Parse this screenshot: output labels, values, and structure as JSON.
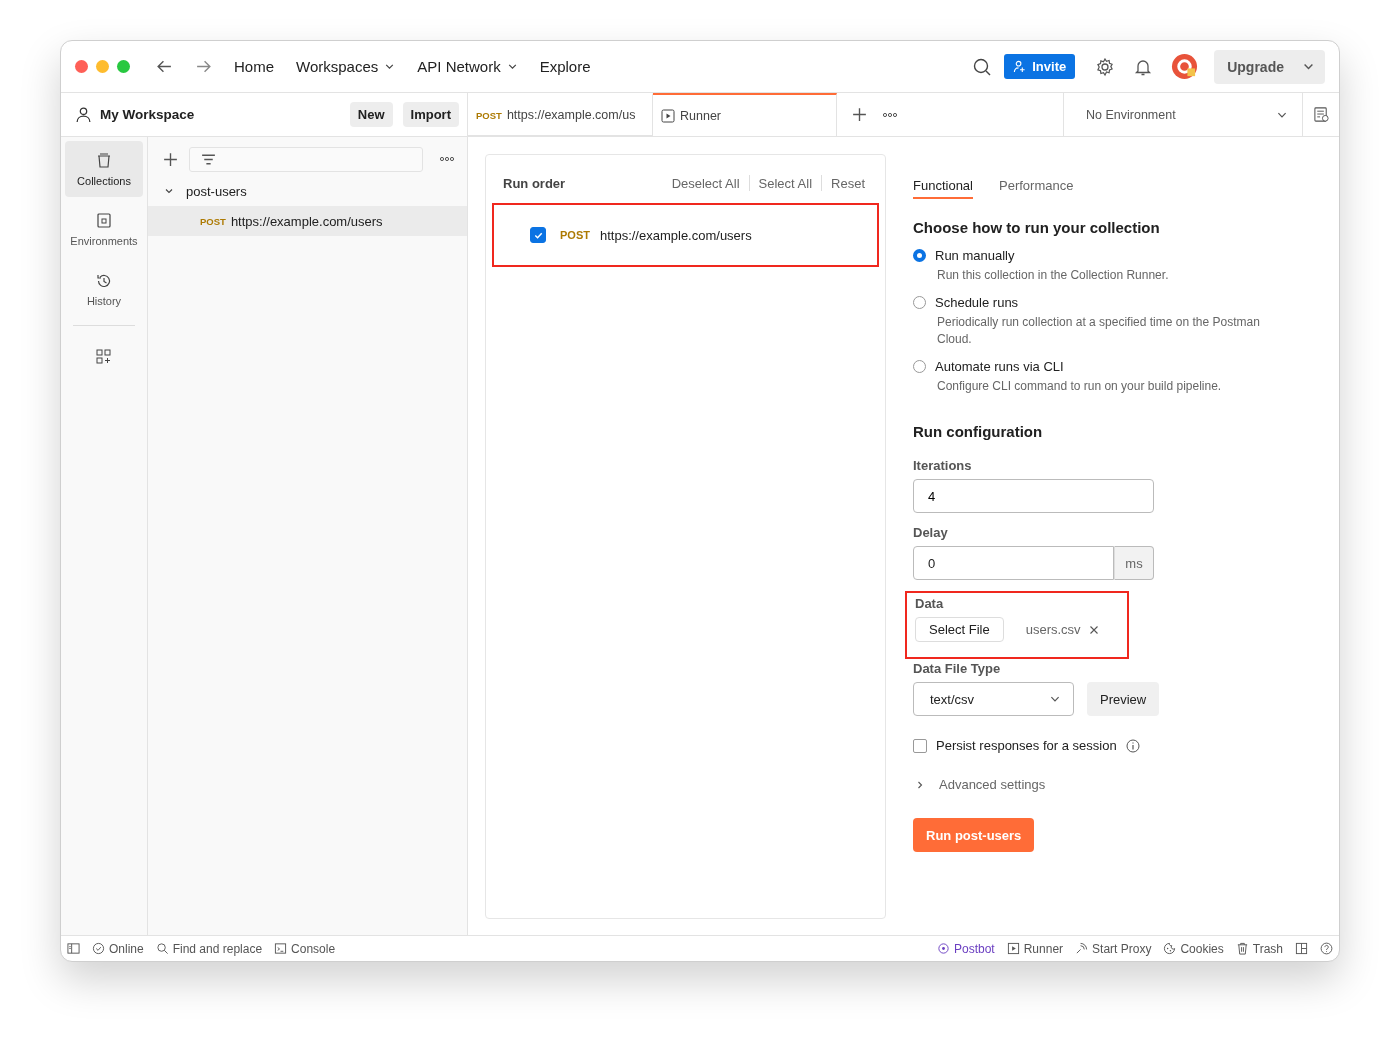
{
  "topbar": {
    "nav": [
      {
        "label": "Home",
        "dropdown": false
      },
      {
        "label": "Workspaces",
        "dropdown": true
      },
      {
        "label": "API Network",
        "dropdown": true
      },
      {
        "label": "Explore",
        "dropdown": false
      }
    ],
    "invite": "Invite",
    "upgrade": "Upgrade"
  },
  "workspace": {
    "name": "My Workspace",
    "buttons": [
      "New",
      "Import"
    ]
  },
  "tabs": [
    {
      "method": "POST",
      "label": "https://example.com/us",
      "selected": false,
      "kind": "request"
    },
    {
      "label": "Runner",
      "selected": true,
      "kind": "runner"
    }
  ],
  "environment": "No Environment",
  "rail": [
    {
      "label": "Collections",
      "selected": true,
      "kind": "collections"
    },
    {
      "label": "Environments",
      "selected": false,
      "kind": "environments"
    },
    {
      "label": "History",
      "selected": false,
      "kind": "history"
    }
  ],
  "tree": [
    {
      "label": "post-users",
      "expanded": true,
      "children": [
        {
          "method": "POST",
          "label": "https://example.com/users",
          "selected": true
        }
      ]
    }
  ],
  "run_order": {
    "title": "Run order",
    "actions": [
      "Deselect All",
      "Select All",
      "Reset"
    ],
    "items": [
      {
        "method": "POST",
        "url": "https://example.com/users",
        "checked": true,
        "highlighted": true
      }
    ]
  },
  "config_tabs": [
    {
      "label": "Functional",
      "selected": true
    },
    {
      "label": "Performance",
      "selected": false
    }
  ],
  "run_heading": "Choose how to run your collection",
  "run_modes": [
    {
      "label": "Run manually",
      "description": "Run this collection in the Collection Runner.",
      "selected": true
    },
    {
      "label": "Schedule runs",
      "description": "Periodically run collection at a specified time on the Postman Cloud.",
      "selected": false
    },
    {
      "label": "Automate runs via CLI",
      "description": "Configure CLI command to run on your build pipeline.",
      "selected": false
    }
  ],
  "config": {
    "heading": "Run configuration",
    "iterations_label": "Iterations",
    "iterations": "4",
    "delay_label": "Delay",
    "delay": "0",
    "delay_unit": "ms",
    "data_label": "Data",
    "select_file": "Select File",
    "file_name": "users.csv",
    "data_highlighted": true,
    "file_type_label": "Data File Type",
    "file_type": "text/csv",
    "preview": "Preview",
    "persist_label": "Persist responses for a session",
    "persist": false,
    "advanced": "Advanced settings",
    "run_button": "Run post-users"
  },
  "status_bar": {
    "left": [
      {
        "label": "Online",
        "kind": "online"
      },
      {
        "label": "Find and replace",
        "kind": "find"
      },
      {
        "label": "Console",
        "kind": "console"
      }
    ],
    "right": [
      {
        "label": "Postbot",
        "kind": "postbot"
      },
      {
        "label": "Runner",
        "kind": "runner"
      },
      {
        "label": "Start Proxy",
        "kind": "proxy"
      },
      {
        "label": "Cookies",
        "kind": "cookies"
      },
      {
        "label": "Trash",
        "kind": "trash"
      }
    ]
  }
}
